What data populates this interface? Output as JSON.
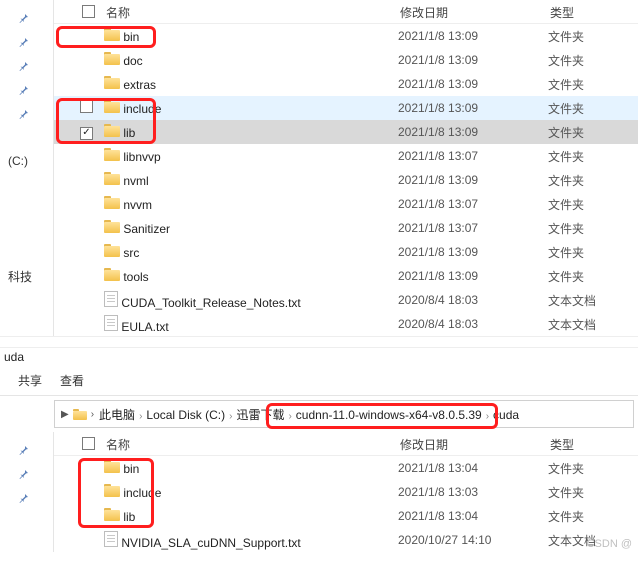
{
  "top": {
    "columns": {
      "name": "名称",
      "date": "修改日期",
      "type": "类型"
    },
    "leftLabels": {
      "drive": "(C:)",
      "section": "科技"
    },
    "rows": [
      {
        "kind": "folder",
        "name": "bin",
        "date": "2021/1/8 13:09",
        "type": "文件夹",
        "chk": null
      },
      {
        "kind": "folder",
        "name": "doc",
        "date": "2021/1/8 13:09",
        "type": "文件夹",
        "chk": null
      },
      {
        "kind": "folder",
        "name": "extras",
        "date": "2021/1/8 13:09",
        "type": "文件夹",
        "chk": null
      },
      {
        "kind": "folder",
        "name": "include",
        "date": "2021/1/8 13:09",
        "type": "文件夹",
        "chk": false,
        "hover": true
      },
      {
        "kind": "folder",
        "name": "lib",
        "date": "2021/1/8 13:09",
        "type": "文件夹",
        "chk": true,
        "selected": true
      },
      {
        "kind": "folder",
        "name": "libnvvp",
        "date": "2021/1/8 13:07",
        "type": "文件夹",
        "chk": null
      },
      {
        "kind": "folder",
        "name": "nvml",
        "date": "2021/1/8 13:09",
        "type": "文件夹",
        "chk": null
      },
      {
        "kind": "folder",
        "name": "nvvm",
        "date": "2021/1/8 13:07",
        "type": "文件夹",
        "chk": null
      },
      {
        "kind": "folder",
        "name": "Sanitizer",
        "date": "2021/1/8 13:07",
        "type": "文件夹",
        "chk": null
      },
      {
        "kind": "folder",
        "name": "src",
        "date": "2021/1/8 13:09",
        "type": "文件夹",
        "chk": null
      },
      {
        "kind": "folder",
        "name": "tools",
        "date": "2021/1/8 13:09",
        "type": "文件夹",
        "chk": null
      },
      {
        "kind": "file",
        "name": "CUDA_Toolkit_Release_Notes.txt",
        "date": "2020/8/4 18:03",
        "type": "文本文档",
        "chk": null
      },
      {
        "kind": "file",
        "name": "EULA.txt",
        "date": "2020/8/4 18:03",
        "type": "文本文档",
        "chk": null
      }
    ]
  },
  "bottom": {
    "title": "uda",
    "tabs": {
      "share": "共享",
      "view": "查看"
    },
    "breadcrumb": {
      "items": [
        "此电脑",
        "Local Disk (C:)",
        "迅雷下载",
        "cudnn-11.0-windows-x64-v8.0.5.39",
        "cuda"
      ]
    },
    "columns": {
      "name": "名称",
      "date": "修改日期",
      "type": "类型"
    },
    "rows": [
      {
        "kind": "folder",
        "name": "bin",
        "date": "2021/1/8 13:04",
        "type": "文件夹"
      },
      {
        "kind": "folder",
        "name": "include",
        "date": "2021/1/8 13:03",
        "type": "文件夹"
      },
      {
        "kind": "folder",
        "name": "lib",
        "date": "2021/1/8 13:04",
        "type": "文件夹"
      },
      {
        "kind": "file",
        "name": "NVIDIA_SLA_cuDNN_Support.txt",
        "date": "2020/10/27 14:10",
        "type": "文本文档"
      }
    ]
  },
  "watermark": "CSDN @"
}
